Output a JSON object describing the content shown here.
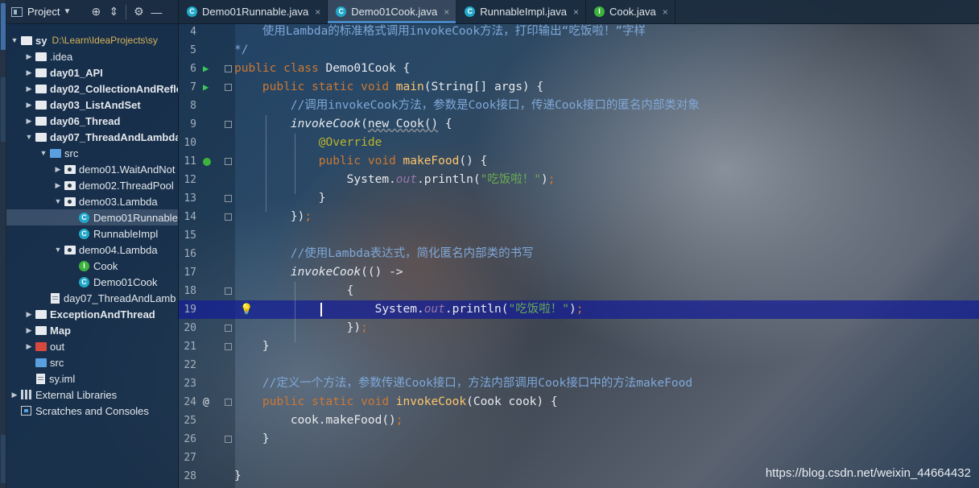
{
  "project_panel": {
    "title": "Project",
    "tree": [
      {
        "label": "sy",
        "path": "D:\\Learn\\IdeaProjects\\sy",
        "icon": "module-folder-icon",
        "bold": true,
        "expanded": true
      },
      {
        "label": ".idea",
        "icon": "folder-icon"
      },
      {
        "label": "day01_API",
        "icon": "module-folder-icon",
        "bold": true
      },
      {
        "label": "day02_CollectionAndRefle",
        "icon": "module-folder-icon",
        "bold": true
      },
      {
        "label": "day03_ListAndSet",
        "icon": "module-folder-icon",
        "bold": true
      },
      {
        "label": "day06_Thread",
        "icon": "module-folder-icon",
        "bold": true
      },
      {
        "label": "day07_ThreadAndLambda",
        "icon": "module-folder-icon",
        "bold": true,
        "expanded": true
      },
      {
        "label": "src",
        "icon": "source-folder-icon",
        "expanded": true
      },
      {
        "label": "demo01.WaitAndNot",
        "icon": "package-icon"
      },
      {
        "label": "demo02.ThreadPool",
        "icon": "package-icon"
      },
      {
        "label": "demo03.Lambda",
        "icon": "package-icon",
        "expanded": true
      },
      {
        "label": "Demo01Runnable",
        "icon": "class-icon",
        "selected": true
      },
      {
        "label": "RunnableImpl",
        "icon": "class-icon"
      },
      {
        "label": "demo04.Lambda",
        "icon": "package-icon",
        "expanded": true
      },
      {
        "label": "Cook",
        "icon": "interface-icon"
      },
      {
        "label": "Demo01Cook",
        "icon": "class-icon"
      },
      {
        "label": "day07_ThreadAndLamb",
        "icon": "iml-file-icon"
      },
      {
        "label": "ExceptionAndThread",
        "icon": "module-folder-icon",
        "bold": true
      },
      {
        "label": "Map",
        "icon": "module-folder-icon",
        "bold": true
      },
      {
        "label": "out",
        "icon": "excluded-folder-icon"
      },
      {
        "label": "src",
        "icon": "source-folder-icon"
      },
      {
        "label": "sy.iml",
        "icon": "iml-file-icon"
      },
      {
        "label": "External Libraries",
        "icon": "libraries-icon"
      },
      {
        "label": "Scratches and Consoles",
        "icon": "scratches-icon"
      }
    ]
  },
  "tabs": [
    {
      "label": "Demo01Runnable.java",
      "kind": "C",
      "active": false
    },
    {
      "label": "Demo01Cook.java",
      "kind": "C",
      "active": true
    },
    {
      "label": "RunnableImpl.java",
      "kind": "C",
      "active": false
    },
    {
      "label": "Cook.java",
      "kind": "I",
      "active": false
    }
  ],
  "tab_close": "×",
  "editor": {
    "current_line": 19,
    "lines": [
      {
        "n": "4",
        "tokens": [
          [
            "    使用Lambda的标准格式调用invokeCook方法，打印输出“吃饭啦！”字样",
            "cm"
          ]
        ]
      },
      {
        "n": "5",
        "tokens": [
          [
            "*/",
            "cm"
          ]
        ]
      },
      {
        "n": "6",
        "gutter": "run",
        "tokens": [
          [
            "public class ",
            "kw"
          ],
          [
            "Demo01Cook {",
            "tx"
          ]
        ]
      },
      {
        "n": "7",
        "gutter": "run",
        "tokens": [
          [
            "    public static void ",
            "kw"
          ],
          [
            "main",
            "fn"
          ],
          [
            "(String[] args) {",
            "tx"
          ]
        ]
      },
      {
        "n": "8",
        "tokens": [
          [
            "        //调用invokeCook方法，参数是Cook接口，传递Cook接口的匿名内部类对象",
            "cm"
          ]
        ]
      },
      {
        "n": "9",
        "tokens": [
          [
            "        ",
            "tx"
          ],
          [
            "invokeCook",
            "tx it"
          ],
          [
            "(",
            "tx"
          ],
          [
            "new Cook()",
            "tx ul"
          ],
          [
            " {",
            "tx"
          ]
        ]
      },
      {
        "n": "10",
        "tokens": [
          [
            "            @Override",
            "ann"
          ]
        ]
      },
      {
        "n": "11",
        "gutter": "impl",
        "tokens": [
          [
            "            public void ",
            "kw"
          ],
          [
            "makeFood",
            "fn"
          ],
          [
            "() {",
            "tx"
          ]
        ]
      },
      {
        "n": "12",
        "tokens": [
          [
            "                System.",
            "tx"
          ],
          [
            "out",
            "fld"
          ],
          [
            ".println(",
            "tx"
          ],
          [
            "\"吃饭啦！\"",
            "st"
          ],
          [
            ")",
            "tx"
          ],
          [
            ";",
            "kw"
          ]
        ]
      },
      {
        "n": "13",
        "tokens": [
          [
            "            }",
            "tx"
          ]
        ]
      },
      {
        "n": "14",
        "tokens": [
          [
            "        })",
            "tx"
          ],
          [
            ";",
            "kw"
          ]
        ]
      },
      {
        "n": "15",
        "tokens": [
          [
            "",
            "tx"
          ]
        ]
      },
      {
        "n": "16",
        "tokens": [
          [
            "        //使用Lambda表达式，简化匿名内部类的书写",
            "cm"
          ]
        ]
      },
      {
        "n": "17",
        "tokens": [
          [
            "        ",
            "tx"
          ],
          [
            "invokeCook",
            "tx it"
          ],
          [
            "(() ->",
            "tx"
          ]
        ]
      },
      {
        "n": "18",
        "tokens": [
          [
            "                {",
            "tx"
          ]
        ]
      },
      {
        "n": "19",
        "gutter": "bulb",
        "tokens": [
          [
            "                    System.",
            "tx"
          ],
          [
            "out",
            "fld"
          ],
          [
            ".println(",
            "tx"
          ],
          [
            "\"吃饭啦！\"",
            "st"
          ],
          [
            ")",
            "tx"
          ],
          [
            ";",
            "kw"
          ]
        ]
      },
      {
        "n": "20",
        "tokens": [
          [
            "                })",
            "tx"
          ],
          [
            ";",
            "kw"
          ]
        ]
      },
      {
        "n": "21",
        "tokens": [
          [
            "    }",
            "tx"
          ]
        ]
      },
      {
        "n": "22",
        "tokens": [
          [
            "",
            "tx"
          ]
        ]
      },
      {
        "n": "23",
        "tokens": [
          [
            "    //定义一个方法，参数传递Cook接口，方法内部调用Cook接口中的方法makeFood",
            "cm"
          ]
        ]
      },
      {
        "n": "24",
        "gutter": "at",
        "tokens": [
          [
            "    public static void ",
            "kw"
          ],
          [
            "invokeCook",
            "fn"
          ],
          [
            "(Cook cook) {",
            "tx"
          ]
        ]
      },
      {
        "n": "25",
        "tokens": [
          [
            "        cook.makeFood()",
            "tx"
          ],
          [
            ";",
            "kw"
          ]
        ]
      },
      {
        "n": "26",
        "tokens": [
          [
            "    }",
            "tx"
          ]
        ]
      },
      {
        "n": "27",
        "tokens": [
          [
            "",
            "tx"
          ]
        ]
      },
      {
        "n": "28",
        "tokens": [
          [
            "}",
            "tx"
          ]
        ]
      }
    ]
  },
  "watermark": "https://blog.csdn.net/weixin_44664432",
  "colors": {
    "keyword": "#cc7832",
    "comment": "#7fa8d8",
    "string": "#6aaa52",
    "function": "#ffc66d",
    "annotation": "#bbb529",
    "current_line": "#1a1e96"
  }
}
